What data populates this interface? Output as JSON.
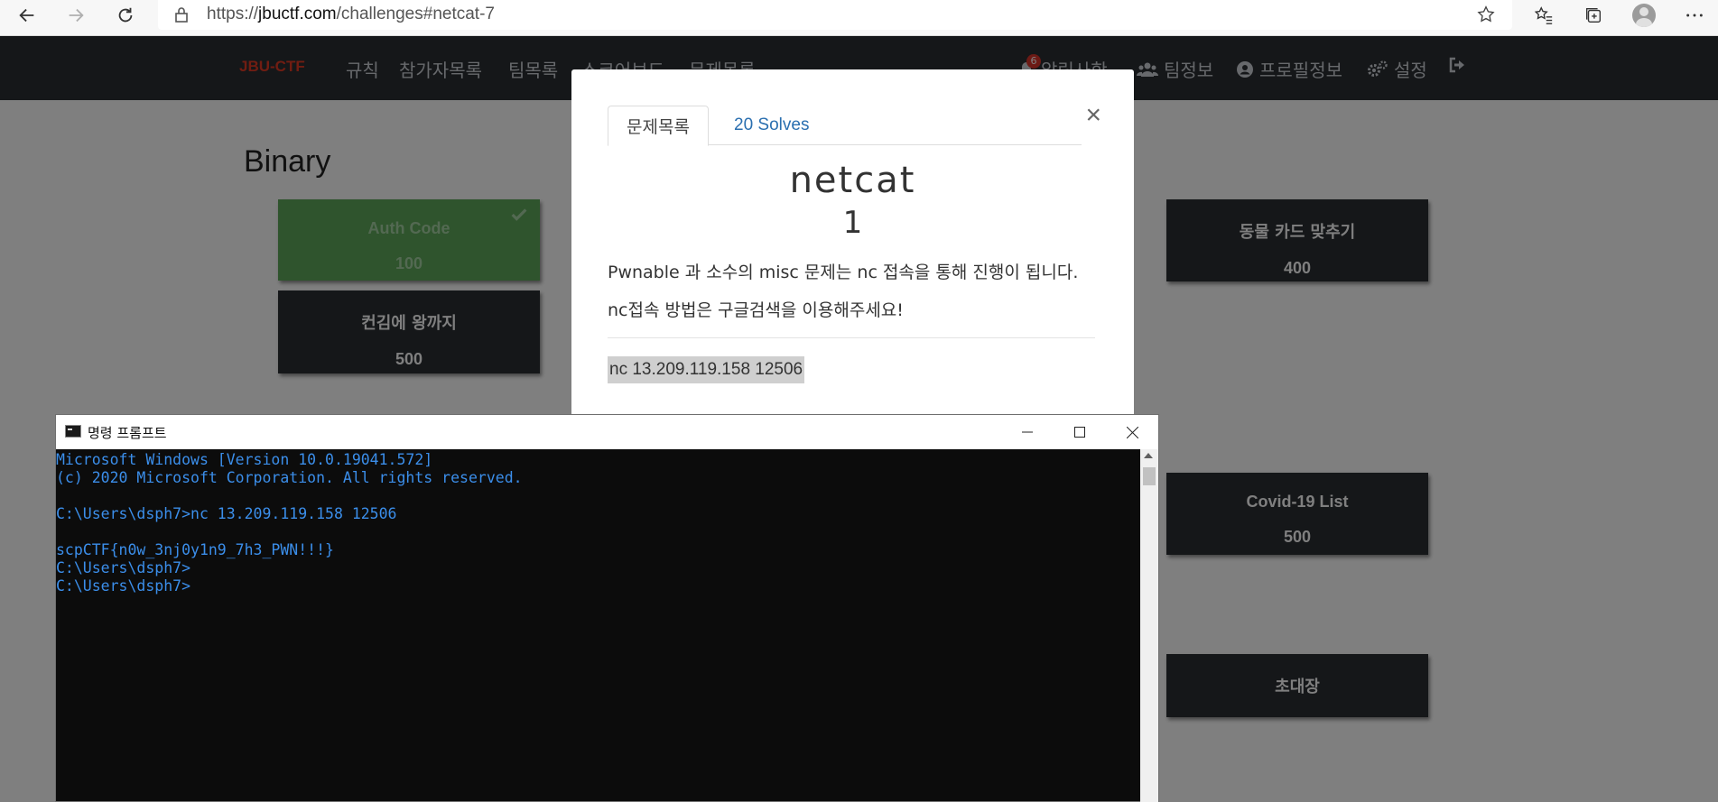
{
  "browser": {
    "url_prefix": "https://",
    "url_host": "jbuctf.com",
    "url_path": "/challenges#netcat-7",
    "icons": [
      "back-icon",
      "forward-icon",
      "reload-icon",
      "lock-icon",
      "star-icon",
      "favorites-icon",
      "collections-icon",
      "profile-icon",
      "more-icon"
    ]
  },
  "site": {
    "brand": "JBU-CTF",
    "nav": [
      "규칙",
      "참가자목록",
      "팀목록",
      "스코어보드",
      "문제목록"
    ],
    "nav_right": {
      "notice": "알림사항",
      "notice_count": "6",
      "team": "팀정보",
      "profile": "프로필정보",
      "settings": "설정"
    },
    "category": "Binary",
    "cards": [
      {
        "title": "Auth Code",
        "value": "100",
        "solved": true
      },
      {
        "title": "컨김에 왕까지",
        "value": "500",
        "solved": false
      },
      {
        "title": "동물 카드 맞추기",
        "value": "400",
        "solved": false
      },
      {
        "title": "Covid-19 List",
        "value": "500",
        "solved": false
      },
      {
        "title": "초대장",
        "value": "",
        "solved": false
      }
    ],
    "colors": {
      "navbar": "#2a2e33",
      "card": "#2a2e33",
      "solved": "#5ea85b",
      "brand": "#e23b24",
      "badge": "#d9342b"
    }
  },
  "modal": {
    "tab_active": "문제목록",
    "tab_solves": "20 Solves",
    "close": "×",
    "name": "netcat",
    "value": "1",
    "desc1": "Pwnable 과 소수의 misc 문제는 nc 접속을 통해 진행이 됩니다.",
    "desc2": "nc접속 방법은 구글검색을 이용해주세요!",
    "command": "nc 13.209.119.158 12506"
  },
  "cmd": {
    "title": "명령 프롬프트",
    "lines": [
      "Microsoft Windows [Version 10.0.19041.572]",
      "(c) 2020 Microsoft Corporation. All rights reserved.",
      "",
      "C:\\Users\\dsph7>nc 13.209.119.158 12506",
      "",
      "scpCTF{n0w_3nj0y1n9_7h3_PWN!!!}",
      "C:\\Users\\dsph7>",
      "C:\\Users\\dsph7>"
    ],
    "colors": {
      "text": "#3b8eea",
      "background": "#0c0c0c"
    }
  }
}
